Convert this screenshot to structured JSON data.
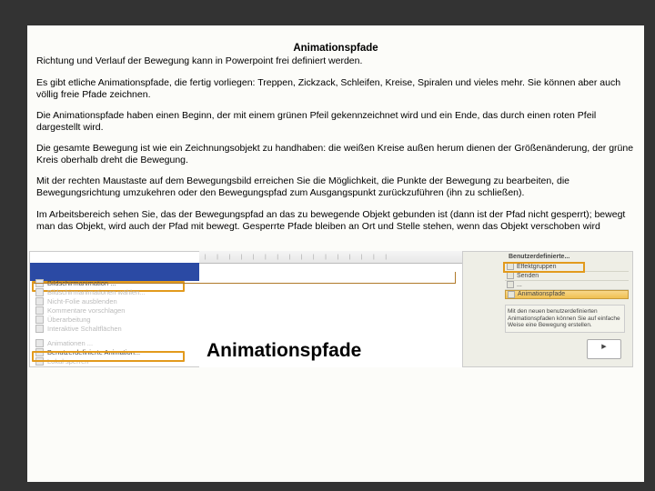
{
  "title": "Animationspfade",
  "paragraphs": [
    "Richtung und Verlauf der Bewegung kann in Powerpoint frei definiert werden.",
    "Es gibt etliche Animationspfade, die fertig vorliegen: Treppen, Zickzack, Schleifen, Kreise, Spiralen und vieles mehr. Sie können aber auch völlig freie Pfade zeichnen.",
    "Die Animationspfade haben einen Beginn, der mit einem grünen Pfeil gekennzeichnet wird und ein Ende, das durch einen roten Pfeil dargestellt wird.",
    "Die gesamte Bewegung ist wie ein Zeichnungsobjekt zu handhaben: die weißen Kreise außen herum dienen der Größenänderung, der grüne Kreis oberhalb dreht die Bewegung.",
    "Mit der rechten Maustaste auf dem Bewegungsbild erreichen Sie die Möglichkeit, die Punkte der Bewegung zu bearbeiten, die Bewegungsrichtung umzukehren oder den Bewegungspfad zum Ausgangspunkt zurückzuführen (ihn zu schließen).",
    "Im Arbeitsbereich sehen Sie, das der Bewegungspfad an das zu bewegende Objekt gebunden ist (dann ist der Pfad nicht gesperrt); bewegt man das Objekt, wird auch der Pfad mit bewegt. Gesperrte Pfade bleiben an Ort und Stelle stehen, wenn das Objekt verschoben wird"
  ],
  "leftThumb": {
    "highlightTop": "Bildschirmanimation ...",
    "menu": [
      "Bildschirmanimationen wählen...",
      "Nicht-Folie ausblenden",
      "Kommentare vorschlagen",
      "Überarbeitung",
      "Interaktive Schaltflächen",
      "Animationen ...",
      "Benutzerdefinierte Animation...",
      "Lokal sperren"
    ],
    "highlightBot": "Benutzerdefinierte Animation..."
  },
  "midThumb": {
    "ruler": "| | | | | | | | | | | | | | | |",
    "title": "Animationspfade"
  },
  "rightThumb": {
    "header": "Benutzerdefinierte...",
    "rows": [
      "Effektgruppen",
      "Senden",
      "...",
      "Animationspfade"
    ],
    "panel": "Mit den neuen benutzerdefinierten Animationspfaden können Sie auf einfache Weise eine Bewegung erstellen.",
    "footer": "▶"
  }
}
